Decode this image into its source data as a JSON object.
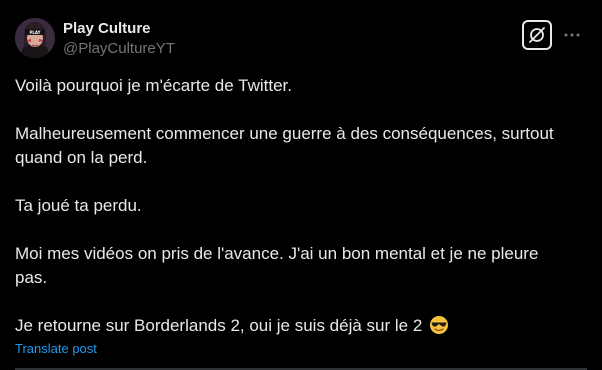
{
  "tweet": {
    "author": {
      "display_name": "Play Culture",
      "handle": "@PlayCultureYT",
      "avatar_icon": "avatar-portrait"
    },
    "actions": {
      "grok_icon": "grok-icon",
      "more_icon": "more-options-icon"
    },
    "paragraphs": [
      "Voilà pourquoi je m'écarte de Twitter.",
      "Malheureusement commencer une guerre à des conséquences, surtout quand on la perd.",
      "Ta joué ta perdu.",
      "Moi mes vidéos on pris de l'avance. J'ai un bon mental et je ne pleure pas.",
      "Je retourne sur Borderlands 2, oui je suis déjà sur le 2"
    ],
    "emoji": "smiling-face-with-sunglasses",
    "translate_label": "Translate post"
  },
  "colors": {
    "background": "#000000",
    "text": "#e7e9ea",
    "secondary_text": "#71767b",
    "link": "#1d9bf0",
    "divider": "#2f3336"
  }
}
